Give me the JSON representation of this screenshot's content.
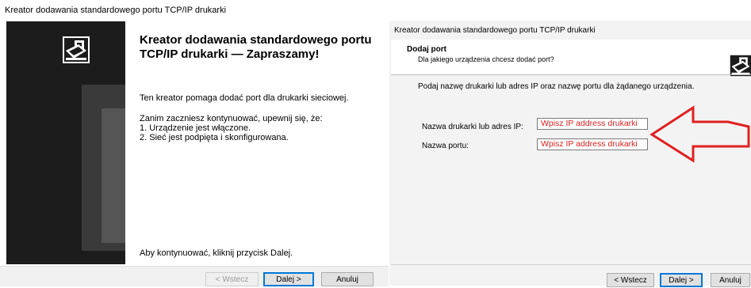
{
  "left_window": {
    "title": "Kreator dodawania standardowego portu TCP/IP drukarki",
    "heading": "Kreator dodawania standardowego portu TCP/IP drukarki — Zapraszamy!",
    "intro": "Ten kreator pomaga dodać port dla drukarki sieciowej.",
    "steps_heading": "Zanim zaczniesz kontynuować, upewnij się, że:",
    "steps": [
      "1.  Urządzenie jest włączone.",
      "2.  Sieć jest podpięta i skonfigurowana."
    ],
    "continue_hint": "Aby kontynuować, kliknij przycisk Dalej.",
    "buttons": {
      "back": "< Wstecz",
      "next": "Dalej >",
      "cancel": "Anuluj"
    },
    "icon": "printer-wizard-icon"
  },
  "right_window": {
    "title": "Kreator dodawania standardowego portu TCP/IP drukarki",
    "header_title": "Dodaj port",
    "header_subtitle": "Dla jakiego urządzenia chcesz dodać port?",
    "prompt": "Podaj nazwę drukarki lub adres IP oraz nazwę portu dla żądanego urządzenia.",
    "fields": {
      "printer_name_label": "Nazwa drukarki lub adres IP:",
      "printer_name_value": "Wpisz IP address drukarki",
      "port_name_label": "Nazwa portu:",
      "port_name_value": "Wpisz IP address drukarki"
    },
    "buttons": {
      "back": "< Wstecz",
      "next": "Dalej >",
      "cancel": "Anuluj"
    },
    "annotation_color": "#e02020",
    "icon": "printer-wizard-icon"
  }
}
